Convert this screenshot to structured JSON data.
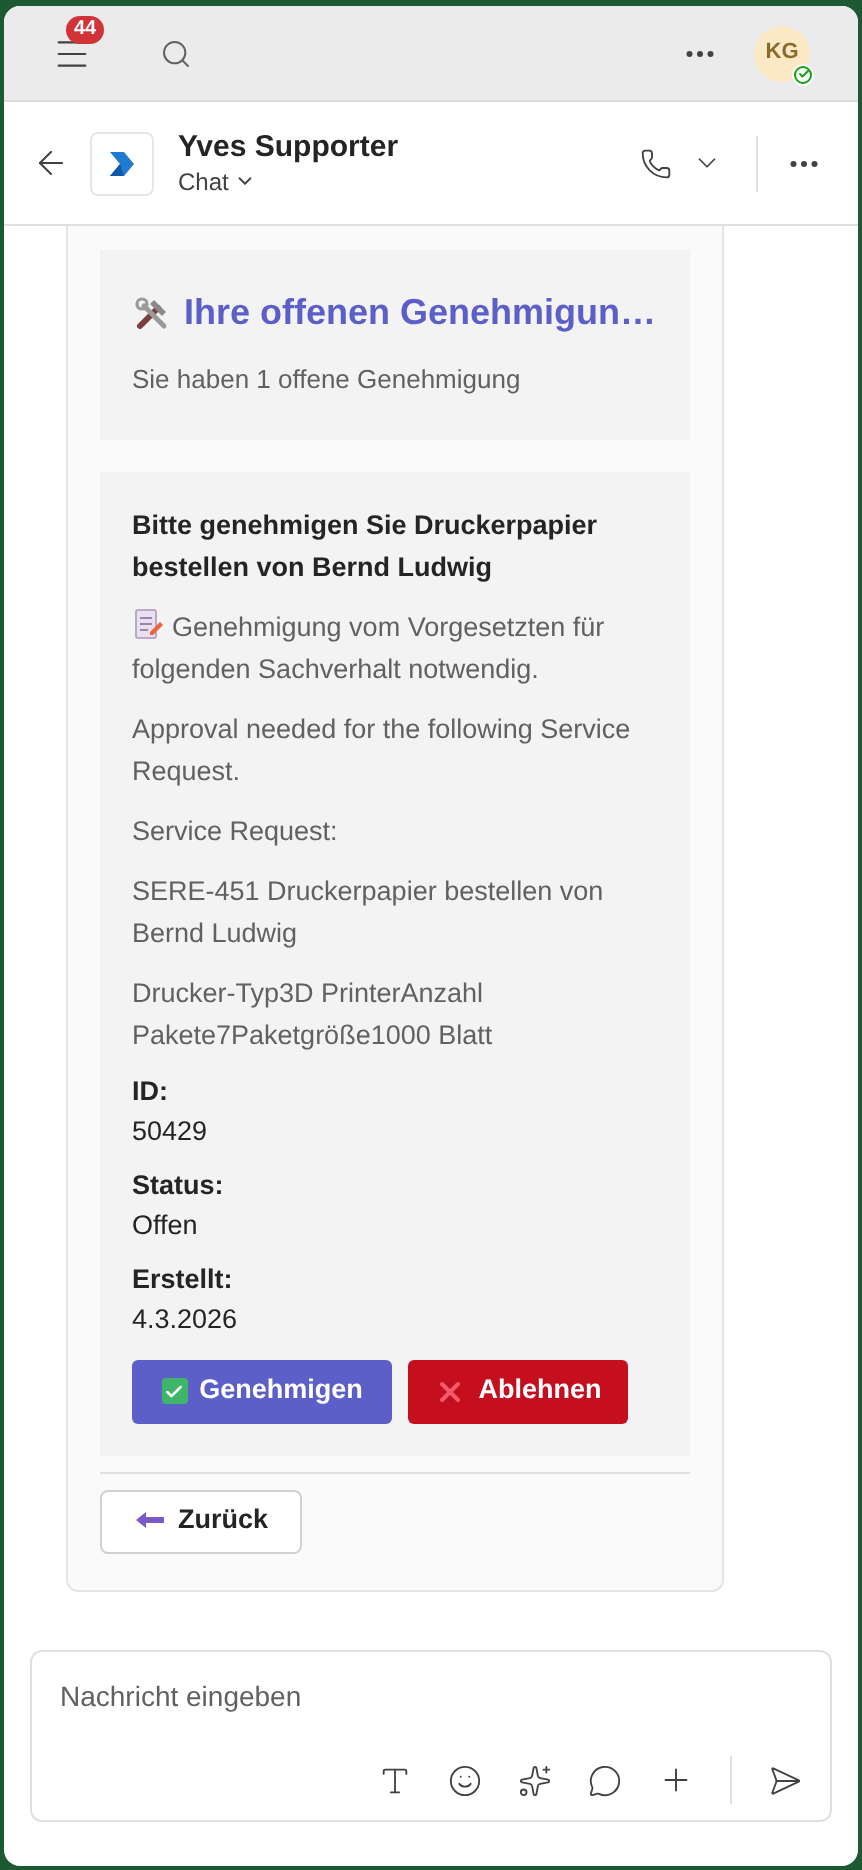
{
  "top_bar": {
    "notification_count": "44",
    "avatar_initials": "KG",
    "online": true
  },
  "chat_header": {
    "title": "Yves Supporter",
    "subtitle": "Chat"
  },
  "card": {
    "summary": {
      "title": "Ihre offenen Genehmigun…",
      "subtitle": "Sie haben 1 offene Genehmigung"
    },
    "request": {
      "title": "Bitte genehmigen Sie Druckerpapier bestellen von Bernd Ludwig",
      "paragraphs": [
        {
          "kind": "memo",
          "text": "Genehmigung vom Vorgesetzten für folgenden Sachverhalt notwendig."
        },
        {
          "kind": "plain",
          "text": "Approval needed for the following Service Request."
        },
        {
          "kind": "plain",
          "text": "Service Request:"
        },
        {
          "kind": "plain",
          "text": "SERE-451 Druckerpapier bestellen von Bernd Ludwig"
        },
        {
          "kind": "plain",
          "text": "Drucker-Typ3D PrinterAnzahl Pakete7Paketgröße1000 Blatt"
        }
      ],
      "fields": [
        {
          "label": "ID:",
          "value": "50429"
        },
        {
          "label": "Status:",
          "value": "Offen"
        },
        {
          "label": "Erstellt:",
          "value": "4.3.2026"
        }
      ],
      "actions": [
        {
          "kind": "approve",
          "label": "Genehmigen"
        },
        {
          "kind": "reject",
          "label": "Ablehnen"
        }
      ]
    },
    "back_button": "Zurück"
  },
  "composer": {
    "placeholder": "Nachricht eingeben"
  }
}
